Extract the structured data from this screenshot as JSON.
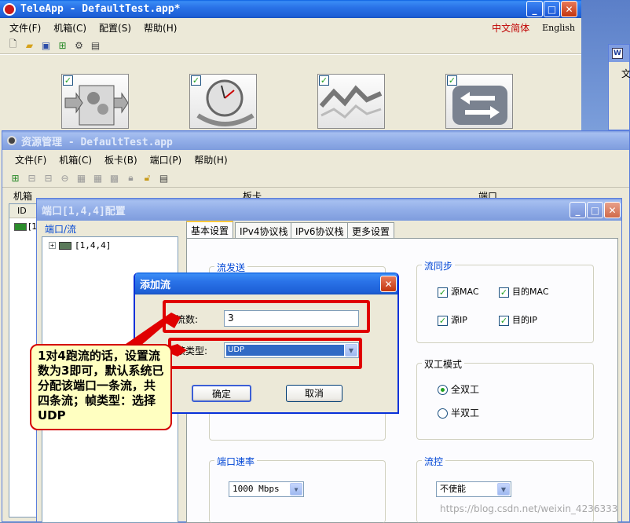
{
  "teleapp": {
    "title": "TeleApp   - DefaultTest.app*",
    "menu": [
      "文件(F)",
      "机箱(C)",
      "配置(S)",
      "帮助(H)"
    ],
    "lang_cn": "中文简体",
    "lang_en": "English"
  },
  "resource_mgr": {
    "title": "资源管理   - DefaultTest.app",
    "menu": [
      "文件(F)",
      "机箱(C)",
      "板卡(B)",
      "端口(P)",
      "帮助(H)"
    ],
    "sections": [
      "机箱",
      "板卡",
      "端口"
    ],
    "col_id": "ID",
    "row_prefix": "[1"
  },
  "port_cfg": {
    "title": "端口[1,4,4]配置",
    "tree_header": "端口/流",
    "tree_node": "[1,4,4]",
    "tabs": [
      "基本设置",
      "IPv4协议栈",
      "IPv6协议栈",
      "更多设置"
    ],
    "stream_send_label": "流发送",
    "stream_sync_label": "流同步",
    "sync_checks": [
      "源MAC",
      "目的MAC",
      "源IP",
      "目的IP"
    ],
    "duplex_label": "双工模式",
    "duplex_options": [
      "全双工",
      "半双工"
    ],
    "speed_label": "端口速率",
    "speed_value": "1000 Mbps",
    "flow_label": "流控",
    "flow_value": "不使能"
  },
  "add_stream": {
    "title": "添加流",
    "count_label": "流数:",
    "count_value": "3",
    "frame_label": "帧类型:",
    "frame_value": "UDP",
    "ok": "确定",
    "cancel": "取消"
  },
  "annotation": {
    "text": "1对4跑流的话，设置流数为3即可，默认系统已分配该端口一条流，共四条流；帧类型：选择UDP"
  },
  "watermark": "https://blog.csdn.net/weixin_4236333"
}
